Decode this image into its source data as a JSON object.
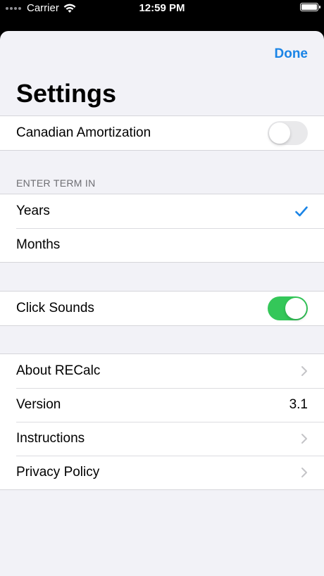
{
  "status_bar": {
    "carrier": "Carrier",
    "time": "12:59 PM",
    "battery_level": 1.0
  },
  "nav": {
    "done_label": "Done",
    "title": "Settings"
  },
  "amortization": {
    "label": "Canadian Amortization",
    "enabled": false
  },
  "term": {
    "header": "ENTER TERM IN",
    "options": [
      {
        "label": "Years",
        "selected": true
      },
      {
        "label": "Months",
        "selected": false
      }
    ]
  },
  "sounds": {
    "label": "Click Sounds",
    "enabled": true
  },
  "info": {
    "about_label": "About RECalc",
    "version_label": "Version",
    "version_value": "3.1",
    "instructions_label": "Instructions",
    "privacy_label": "Privacy Policy"
  },
  "colors": {
    "accent": "#1a84e6",
    "switch_on": "#34c759",
    "switch_off": "#e9e9eb",
    "background": "#f2f2f7"
  },
  "icons": {
    "checkmark": "checkmark-icon",
    "chevron": "chevron-right-icon",
    "wifi": "wifi-icon",
    "battery": "battery-icon"
  }
}
